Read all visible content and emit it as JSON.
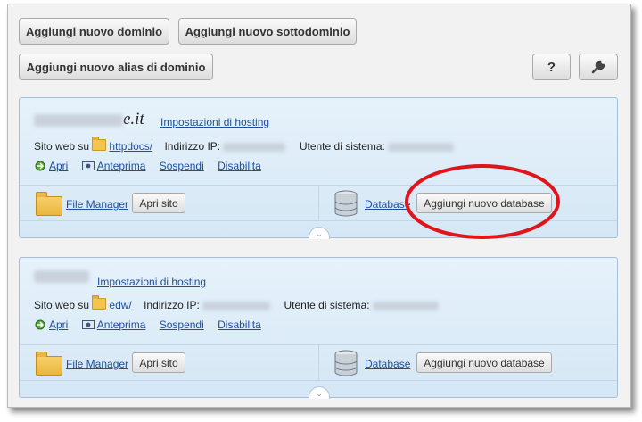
{
  "toolbar": {
    "add_domain": "Aggiungi nuovo dominio",
    "add_subdomain": "Aggiungi nuovo sottodominio",
    "add_alias": "Aggiungi nuovo alias di dominio",
    "help": "?",
    "settings_icon": "wrench-icon"
  },
  "domains": [
    {
      "name_suffix": "e.it",
      "hosting_link": "Impostazioni di hosting",
      "website_label": "Sito web su",
      "folder": "httpdocs/",
      "ip_label": "Indirizzo IP:",
      "user_label": "Utente di sistema:",
      "actions": [
        "Apri",
        "Anteprima",
        "Sospendi",
        "Disabilita"
      ],
      "file_manager": "File Manager",
      "open_site": "Apri sito",
      "database": "Database",
      "add_database": "Aggiungi nuovo database"
    },
    {
      "hosting_link": "Impostazioni di hosting",
      "website_label": "Sito web su",
      "folder": "edw/",
      "ip_label": "Indirizzo IP:",
      "user_label": "Utente di sistema:",
      "actions": [
        "Apri",
        "Anteprima",
        "Sospendi",
        "Disabilita"
      ],
      "file_manager": "File Manager",
      "open_site": "Apri sito",
      "database": "Database",
      "add_database": "Aggiungi nuovo database"
    }
  ],
  "annotation": {
    "color": "#e0141b"
  }
}
